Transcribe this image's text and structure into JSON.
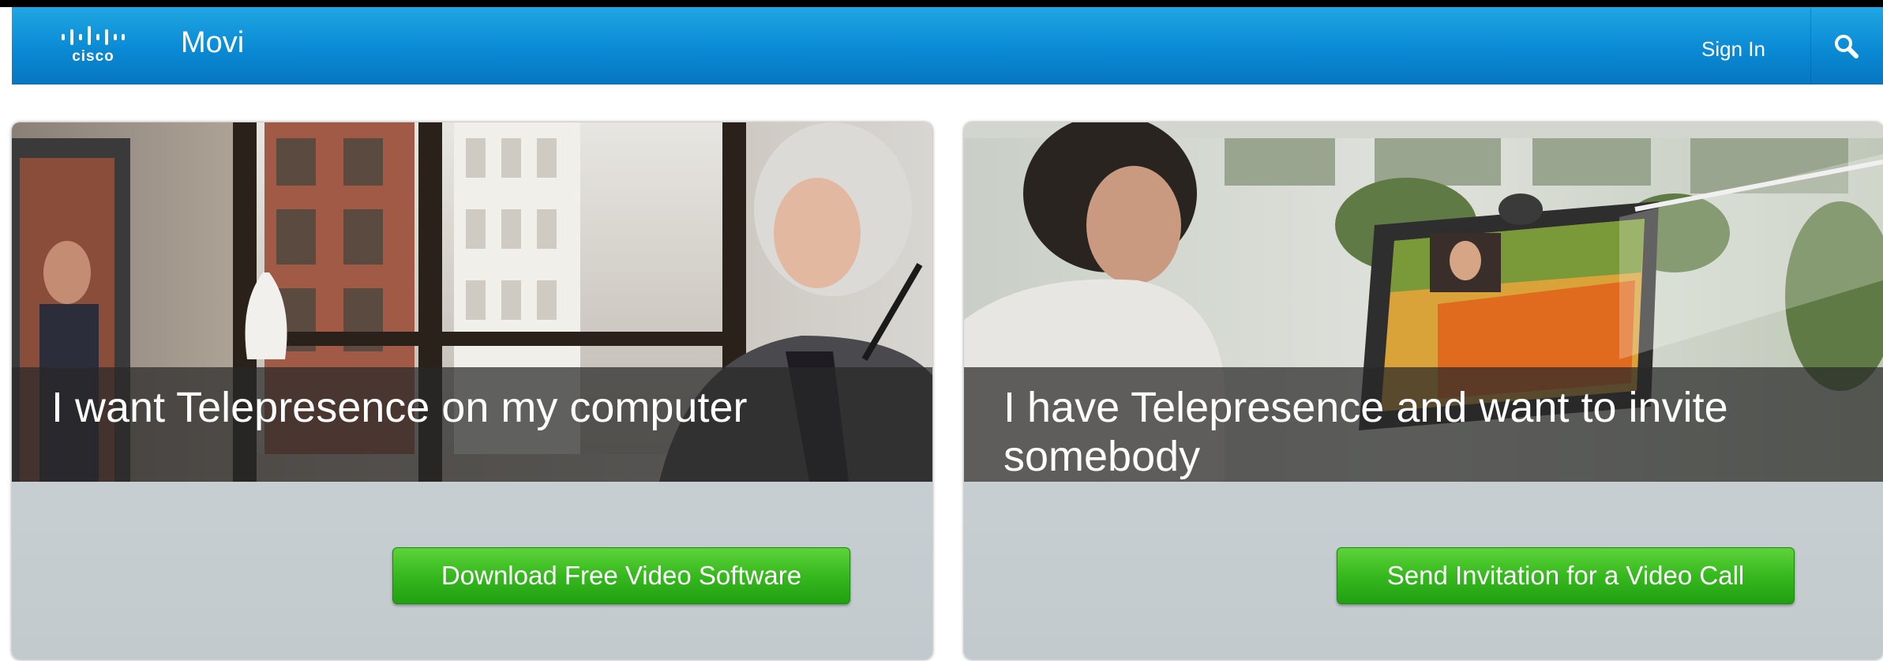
{
  "header": {
    "brand": "cisco",
    "app_title": "Movi",
    "sign_in_label": "Sign In",
    "search_icon": "search-icon"
  },
  "cards": [
    {
      "caption": "I want Telepresence on my computer",
      "button_label": "Download Free Video Software",
      "photo": "woman-at-office-desk-with-video-screen"
    },
    {
      "caption": "I have Telepresence and want to invite somebody",
      "button_label": "Send Invitation for a Video Call",
      "photo": "man-on-video-call-at-monitor"
    }
  ],
  "colors": {
    "header_blue": "#0a8ad4",
    "button_green": "#37b81f",
    "card_gray": "#c9d0d3"
  }
}
